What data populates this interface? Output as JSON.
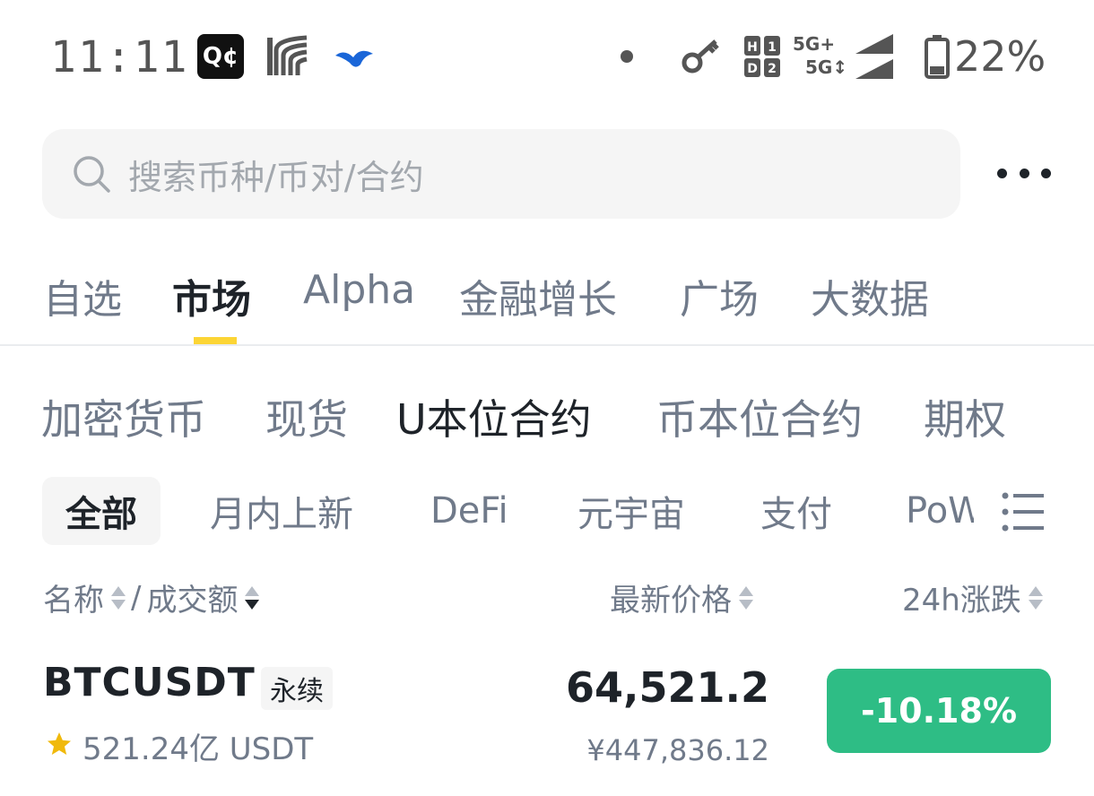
{
  "status_bar": {
    "time": "11:11",
    "app_icon_1_text": "Q¢",
    "network_top": "5G+",
    "network_bottom": "5G",
    "battery": "22%"
  },
  "search": {
    "placeholder": "搜索币种/币对/合约"
  },
  "main_tabs": [
    "自选",
    "市场",
    "Alpha",
    "金融增长",
    "广场",
    "大数据"
  ],
  "main_tab_active": "市场",
  "sub_tabs": [
    "加密货币",
    "现货",
    "U本位合约",
    "币本位合约",
    "期权"
  ],
  "sub_tab_active": "U本位合约",
  "chips": [
    "全部",
    "月内上新",
    "DeFi",
    "元宇宙",
    "支付",
    "PoW"
  ],
  "chip_active": "全部",
  "columns": {
    "name": "名称",
    "separator": "/",
    "volume": "成交额",
    "price": "最新价格",
    "change": "24h涨跌"
  },
  "rows": [
    {
      "symbol": "BTCUSDT",
      "badge": "永续",
      "volume": "521.24亿 USDT",
      "price": "64,521.2",
      "fiat_price": "¥447,836.12",
      "change": "-10.18%",
      "favorite": true
    }
  ],
  "colors": {
    "accent": "#fcd535",
    "change_badge": "#2ebd85",
    "favorite_star": "#f0b90b"
  }
}
